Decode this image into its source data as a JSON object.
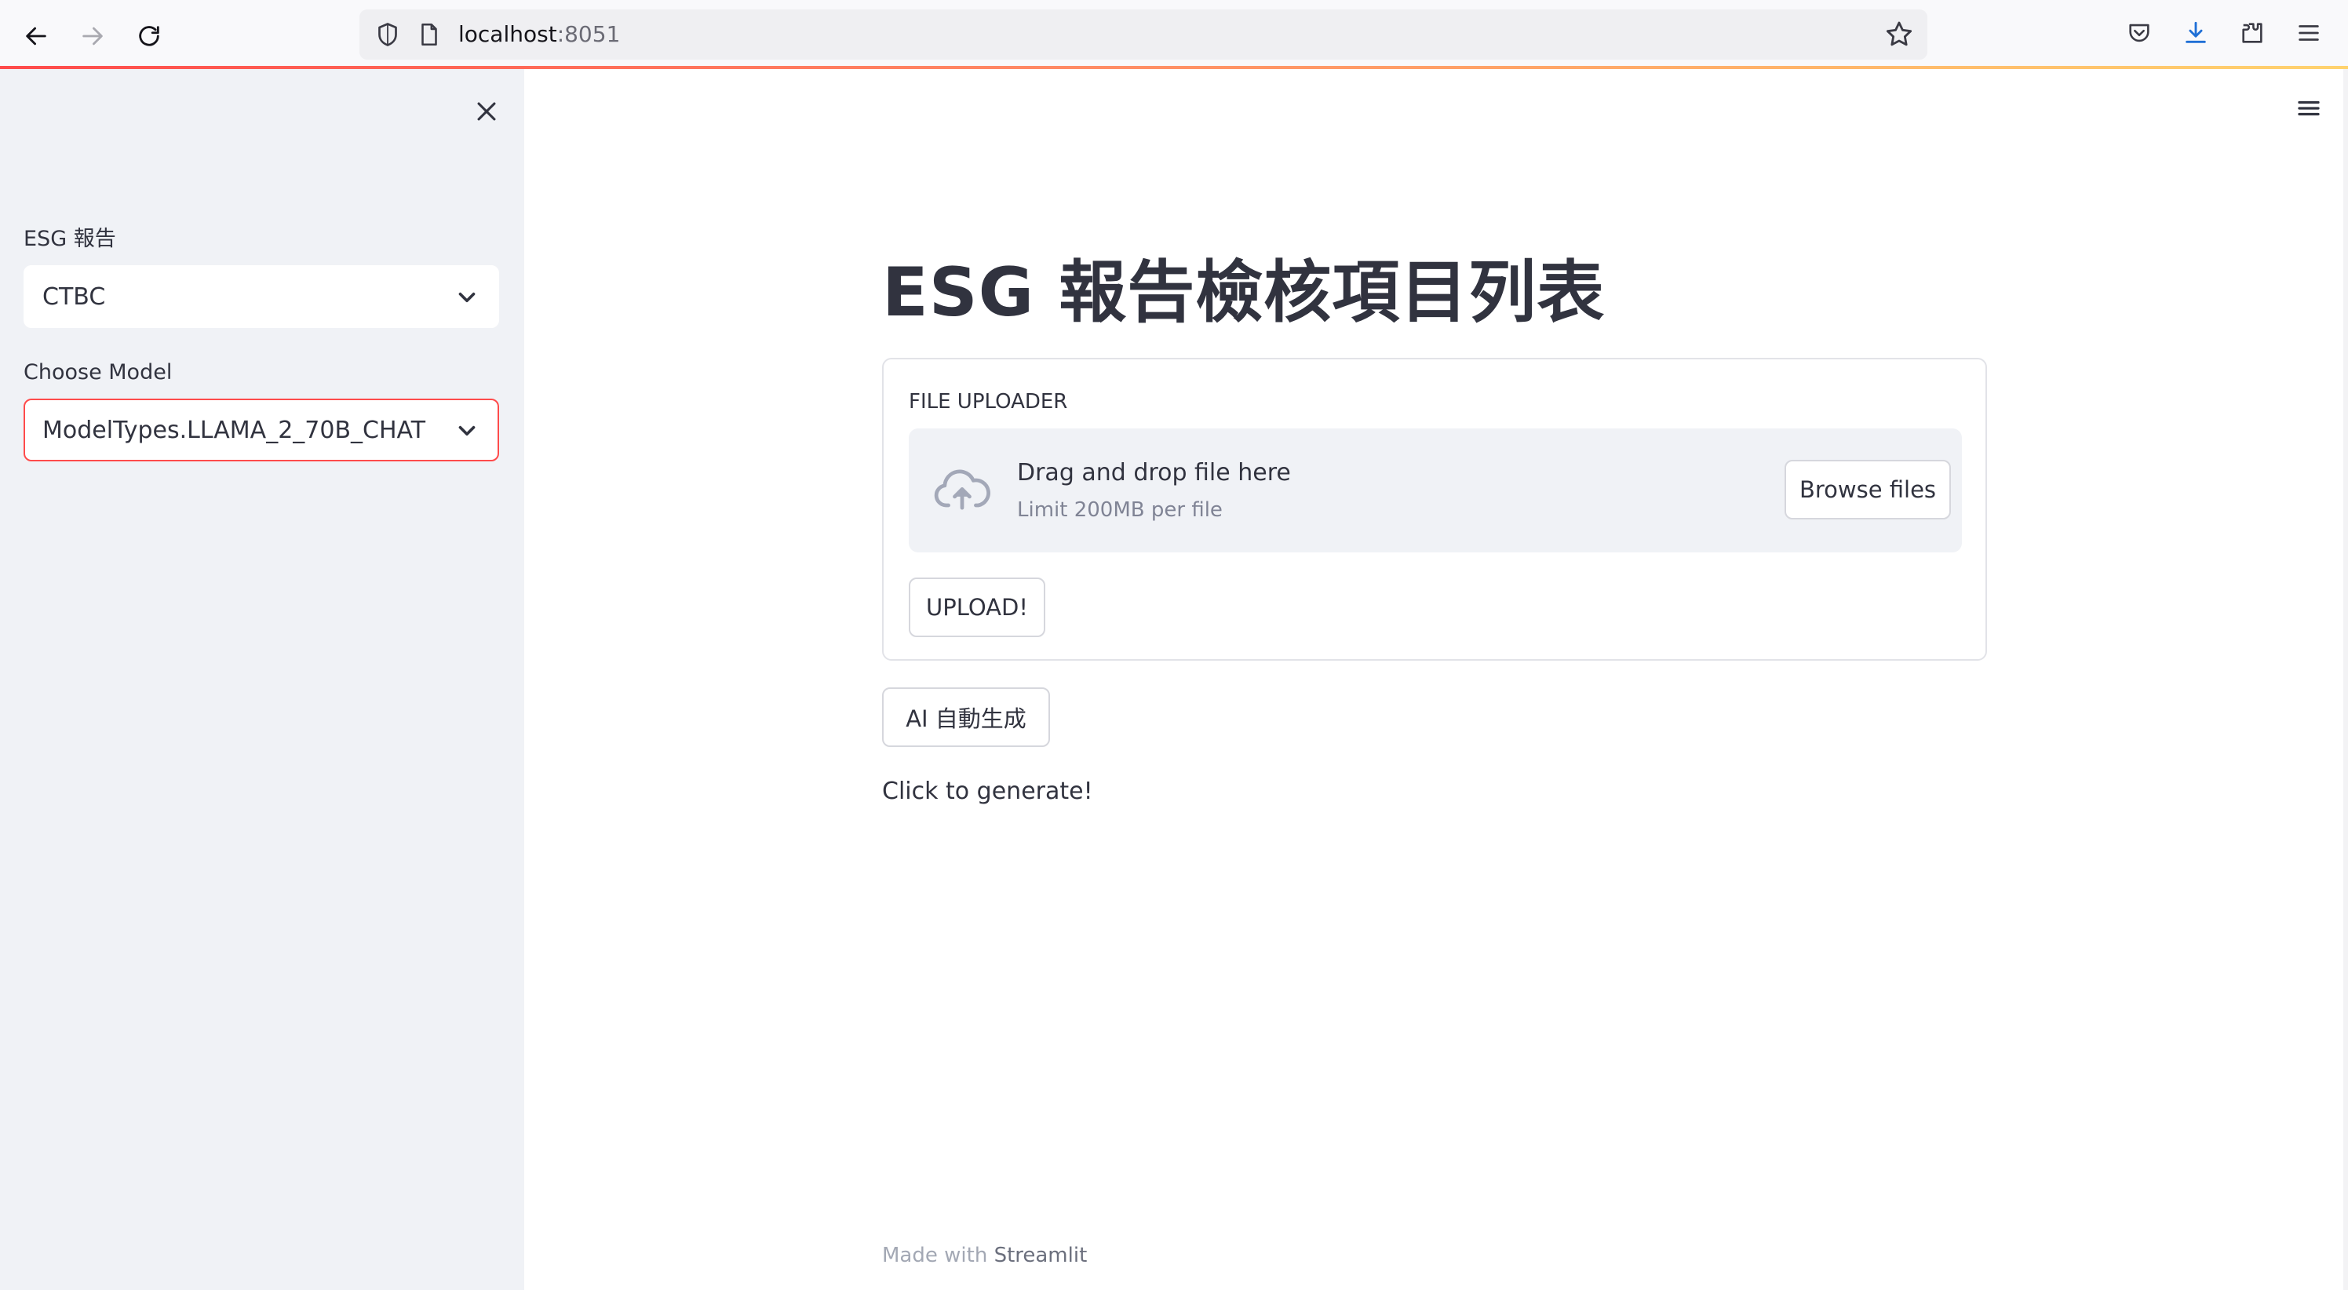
{
  "browser": {
    "url_host": "localhost",
    "url_port": ":8051"
  },
  "sidebar": {
    "report_label": "ESG 報告",
    "report_value": "CTBC",
    "model_label": "Choose Model",
    "model_value": "ModelTypes.LLAMA_2_70B_CHAT"
  },
  "main": {
    "title": "ESG 報告檢核項目列表",
    "uploader": {
      "label": "FILE UPLOADER",
      "drop_title": "Drag and drop file here",
      "drop_limit": "Limit 200MB per file",
      "browse_label": "Browse files"
    },
    "upload_button": "UPLOAD!",
    "ai_button": "AI 自動生成",
    "generate_text": "Click to generate!"
  },
  "footer": {
    "made_with": "Made with ",
    "brand": "Streamlit"
  },
  "colors": {
    "accent": "#ff4b4b",
    "sidebar_bg": "#f0f2f6",
    "text": "#31333f"
  },
  "icons": [
    "back-icon",
    "forward-icon",
    "reload-icon",
    "shield-icon",
    "page-icon",
    "star-icon",
    "pocket-icon",
    "download-icon",
    "extensions-icon",
    "browser-menu-icon",
    "close-icon",
    "chevron-down-icon",
    "hamburger-menu-icon",
    "cloud-upload-icon"
  ]
}
